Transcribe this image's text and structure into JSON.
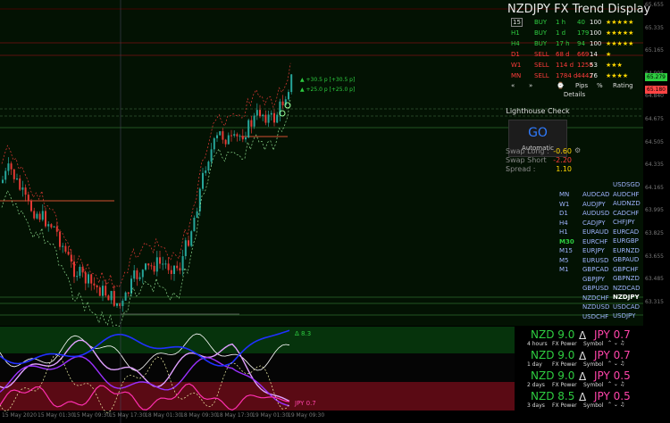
{
  "title": "NZDJPY FX Trend Display",
  "trend_rows": [
    {
      "tf": "15",
      "dir": "BUY",
      "age": "1 h",
      "pips": "40",
      "pct": "100",
      "stars": "★★★★★",
      "color": "green"
    },
    {
      "tf": "H1",
      "dir": "BUY",
      "age": "1 d",
      "pips": "179",
      "pct": "100",
      "stars": "★★★★★",
      "color": "green"
    },
    {
      "tf": "H4",
      "dir": "BUY",
      "age": "17 h",
      "pips": "94",
      "pct": "100",
      "stars": "★★★★★",
      "color": "green"
    },
    {
      "tf": "D1",
      "dir": "SELL",
      "age": "68 d",
      "pips": "669",
      "pct": "14",
      "stars": "★",
      "color": "red"
    },
    {
      "tf": "W1",
      "dir": "SELL",
      "age": "114 d",
      "pips": "1258",
      "pct": "53",
      "stars": "★★★",
      "color": "red"
    },
    {
      "tf": "MN",
      "dir": "SELL",
      "age": "1784 d",
      "pips": "4442",
      "pct": "76",
      "stars": "★★★★",
      "color": "red"
    }
  ],
  "header_labels": [
    "«",
    "»",
    "⌚",
    "Pips",
    "%",
    "Rating"
  ],
  "details_label": "Details",
  "lighthouse": {
    "caption": "Lighthouse Check",
    "go": "GO",
    "mode": "Automatic"
  },
  "swap": [
    {
      "label": "Swap Long :",
      "value": "-0.60",
      "color": "#ffd700"
    },
    {
      "label": "Swap Short :",
      "value": "-2.20",
      "color": "#ff3b3b"
    },
    {
      "label": "Spread :",
      "value": "1.10",
      "color": "#ffd700"
    }
  ],
  "timeframes": [
    "MN",
    "W1",
    "D1",
    "H4",
    "H1",
    "M30",
    "M15",
    "M5",
    "M1"
  ],
  "pairs_col1": [
    "AUDCAD",
    "AUDJPY",
    "AUDUSD",
    "CADJPY",
    "EURAUD",
    "EURCHF",
    "EURJPY",
    "EURUSD",
    "GBPCAD",
    "GBPJPY",
    "GBPUSD",
    "NZDCHF",
    "NZDUSD",
    "USDCHF"
  ],
  "pairs_col2": [
    "USDSGD",
    "AUDCHF",
    "AUDNZD",
    "CADCHF",
    "CHFJPY",
    "EURCAD",
    "EURGBP",
    "EURNZD",
    "GBPAUD",
    "GBPCHF",
    "GBPNZD",
    "NZDCAD",
    "NZDJPY",
    "USDCAD",
    "USDJPY"
  ],
  "prices": [
    "65.655",
    "65.335",
    "65.165",
    "64.995",
    "64.840",
    "64.675",
    "64.505",
    "64.335",
    "64.165",
    "63.995",
    "63.825",
    "63.655",
    "63.485",
    "63.315"
  ],
  "price_tags": [
    {
      "text": "65.279",
      "color": "#2ecc40"
    },
    {
      "text": "65.180",
      "color": "#ff4444"
    }
  ],
  "arrow_labels": [
    "+30.5 p [+30.5 p]",
    "+25.0 p [+25.0 p]"
  ],
  "dates": [
    "15 May 2020",
    "15 May 01:30",
    "15 May 09:30",
    "15 May 17:30",
    "18 May 01:30",
    "18 May 09:30",
    "18 May 17:30",
    "19 May 01:30",
    "19 May 09:30"
  ],
  "indicator_labels": {
    "nzd": "Δ 8.3",
    "jpy": "JPY 0.7"
  },
  "fx_power": [
    {
      "nzd": "NZD 9.0",
      "delta": "Δ",
      "jpy": "JPY 0.7",
      "period": "4 hours",
      "a": "FX Power",
      "b": "Symbol"
    },
    {
      "nzd": "NZD 9.0",
      "delta": "Δ",
      "jpy": "JPY 0.7",
      "period": "1 day",
      "a": "FX Power",
      "b": "Symbol"
    },
    {
      "nzd": "NZD 9.0",
      "delta": "Δ",
      "jpy": "JPY 0.5",
      "period": "2 days",
      "a": "FX Power",
      "b": "Symbol"
    },
    {
      "nzd": "NZD 8.5",
      "delta": "Δ",
      "jpy": "JPY 0.5",
      "period": "3 days",
      "a": "FX Power",
      "b": "Symbol"
    }
  ],
  "colors": {
    "bull": "#26a69a",
    "bear": "#e53935",
    "strong": "#2ecc40",
    "weak": "#ff3b3b",
    "accent": "#2f7bff"
  }
}
